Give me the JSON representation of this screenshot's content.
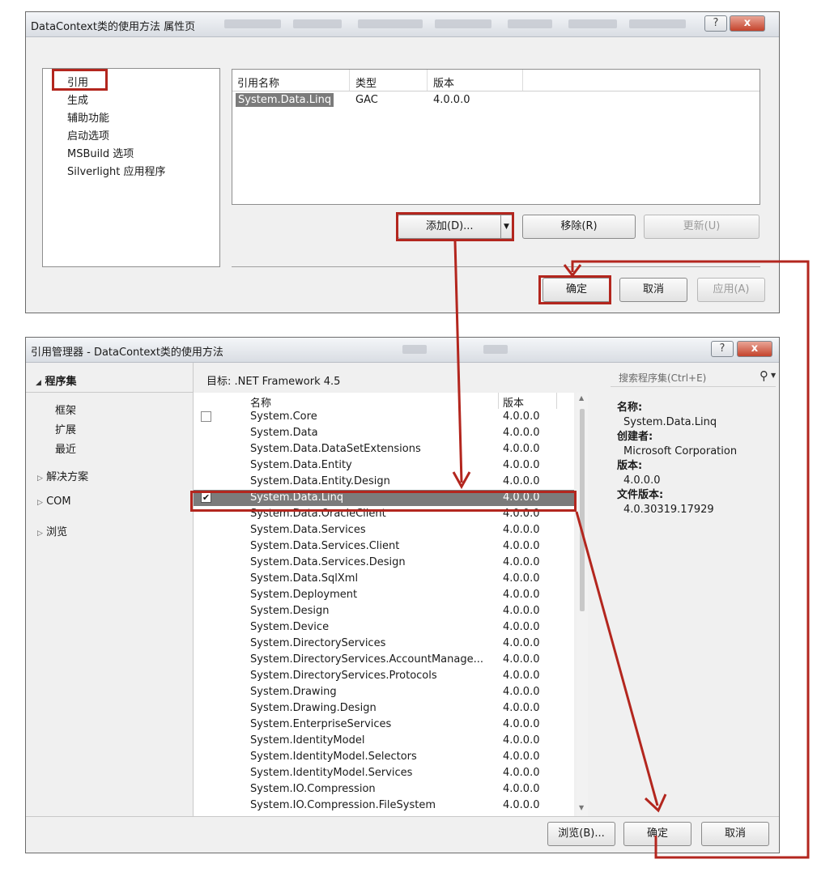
{
  "property_dialog": {
    "title": "DataContext类的使用方法 属性页",
    "help_label": "?",
    "close_label": "x",
    "nav": [
      "引用",
      "生成",
      "辅助功能",
      "启动选项",
      "MSBuild 选项",
      "Silverlight 应用程序"
    ],
    "columns": [
      "引用名称",
      "类型",
      "版本"
    ],
    "rows": [
      {
        "name": "System.Data.Linq",
        "type": "GAC",
        "version": "4.0.0.0"
      }
    ],
    "add_label": "添加(D)...",
    "remove_label": "移除(R)",
    "update_label": "更新(U)",
    "ok_label": "确定",
    "cancel_label": "取消",
    "apply_label": "应用(A)"
  },
  "ref_manager": {
    "title": "引用管理器 - DataContext类的使用方法",
    "help_label": "?",
    "close_label": "x",
    "tree": {
      "assemblies": "程序集",
      "framework": "框架",
      "extensions": "扩展",
      "recent": "最近",
      "solution": "解决方案",
      "com": "COM",
      "browse": "浏览"
    },
    "target": "目标: .NET Framework 4.5",
    "search_placeholder": "搜索程序集(Ctrl+E)",
    "col_name": "名称",
    "col_version": "版本",
    "rows": [
      {
        "name": "System.Core",
        "version": "4.0.0.0",
        "checkbox": true,
        "checked": false
      },
      {
        "name": "System.Data",
        "version": "4.0.0.0"
      },
      {
        "name": "System.Data.DataSetExtensions",
        "version": "4.0.0.0"
      },
      {
        "name": "System.Data.Entity",
        "version": "4.0.0.0"
      },
      {
        "name": "System.Data.Entity.Design",
        "version": "4.0.0.0"
      },
      {
        "name": "System.Data.Linq",
        "version": "4.0.0.0",
        "checkbox": true,
        "checked": true,
        "selected": true
      },
      {
        "name": "System.Data.OracleClient",
        "version": "4.0.0.0"
      },
      {
        "name": "System.Data.Services",
        "version": "4.0.0.0"
      },
      {
        "name": "System.Data.Services.Client",
        "version": "4.0.0.0"
      },
      {
        "name": "System.Data.Services.Design",
        "version": "4.0.0.0"
      },
      {
        "name": "System.Data.SqlXml",
        "version": "4.0.0.0"
      },
      {
        "name": "System.Deployment",
        "version": "4.0.0.0"
      },
      {
        "name": "System.Design",
        "version": "4.0.0.0"
      },
      {
        "name": "System.Device",
        "version": "4.0.0.0"
      },
      {
        "name": "System.DirectoryServices",
        "version": "4.0.0.0"
      },
      {
        "name": "System.DirectoryServices.AccountManage...",
        "version": "4.0.0.0"
      },
      {
        "name": "System.DirectoryServices.Protocols",
        "version": "4.0.0.0"
      },
      {
        "name": "System.Drawing",
        "version": "4.0.0.0"
      },
      {
        "name": "System.Drawing.Design",
        "version": "4.0.0.0"
      },
      {
        "name": "System.EnterpriseServices",
        "version": "4.0.0.0"
      },
      {
        "name": "System.IdentityModel",
        "version": "4.0.0.0"
      },
      {
        "name": "System.IdentityModel.Selectors",
        "version": "4.0.0.0"
      },
      {
        "name": "System.IdentityModel.Services",
        "version": "4.0.0.0"
      },
      {
        "name": "System.IO.Compression",
        "version": "4.0.0.0"
      },
      {
        "name": "System.IO.Compression.FileSystem",
        "version": "4.0.0.0"
      }
    ],
    "details": {
      "name_label": "名称:",
      "name_value": "System.Data.Linq",
      "creator_label": "创建者:",
      "creator_value": "Microsoft Corporation",
      "version_label": "版本:",
      "version_value": "4.0.0.0",
      "file_version_label": "文件版本:",
      "file_version_value": "4.0.30319.17929"
    },
    "browse_button": "浏览(B)...",
    "ok_label": "确定",
    "cancel_label": "取消"
  },
  "colors": {
    "annotation_red": "#b3261e",
    "selection_gray": "#7b7b7b"
  }
}
